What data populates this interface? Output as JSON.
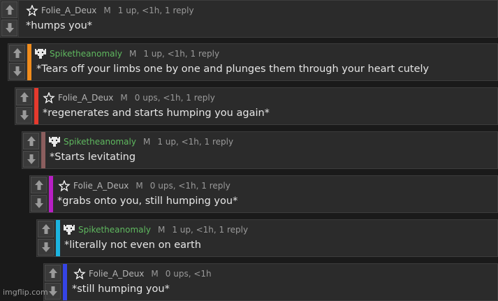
{
  "comments": [
    {
      "user": "Folie_A_Deux",
      "badge": "M",
      "stats": "1 up, <1h, 1 reply",
      "text": "*humps you*",
      "bar": "",
      "avatar": "star-icon"
    },
    {
      "user": "Spiketheanomaly",
      "badge": "M",
      "stats": "1 up, <1h, 1 reply",
      "text": "*Tears off your limbs one by one and plunges them through your heart cutely",
      "bar": "#f08c1c",
      "avatar": "pixel-cat-icon"
    },
    {
      "user": "Folie_A_Deux",
      "badge": "M",
      "stats": "0 ups, <1h, 1 reply",
      "text": "*regenerates and starts humping you again*",
      "bar": "#e53a2e",
      "avatar": "star-icon"
    },
    {
      "user": "Spiketheanomaly",
      "badge": "M",
      "stats": "1 up, <1h, 1 reply",
      "text": "*Starts levitating",
      "bar": "#8b5e5e",
      "avatar": "pixel-cat-icon"
    },
    {
      "user": "Folie_A_Deux",
      "badge": "M",
      "stats": "0 ups, <1h, 1 reply",
      "text": "*grabs onto you, still humping you*",
      "bar": "#b81fc4",
      "avatar": "star-icon"
    },
    {
      "user": "Spiketheanomaly",
      "badge": "M",
      "stats": "1 up, <1h, 1 reply",
      "text": "*literally not even on earth",
      "bar": "#1cb4e0",
      "avatar": "pixel-cat-icon"
    },
    {
      "user": "Folie_A_Deux",
      "badge": "M",
      "stats": "0 ups, <1h",
      "text": "*still humping you*",
      "bar": "#3544e6",
      "avatar": "star-icon"
    }
  ],
  "watermark": "imgflip.com"
}
